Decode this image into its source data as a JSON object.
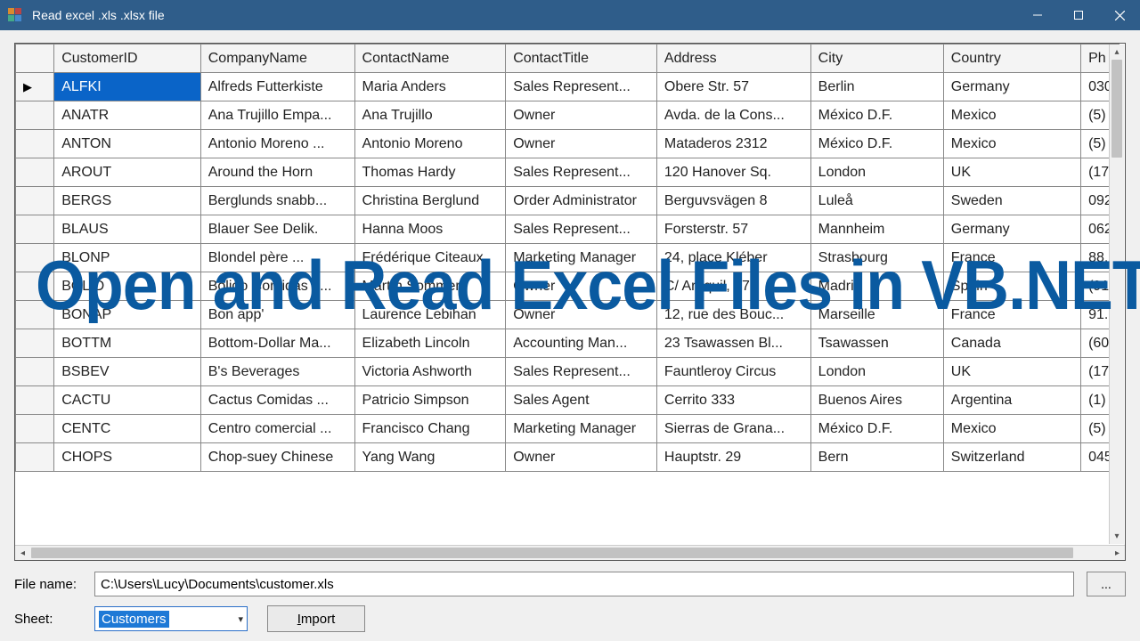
{
  "window": {
    "title": "Read excel .xls .xlsx file"
  },
  "overlay": "Open and Read Excel Files in VB.NET",
  "grid": {
    "columns": [
      "CustomerID",
      "CompanyName",
      "ContactName",
      "ContactTitle",
      "Address",
      "City",
      "Country",
      "Ph"
    ],
    "rows": [
      {
        "sel": true,
        "id": "ALFKI",
        "comp": "Alfreds Futterkiste",
        "contact": "Maria Anders",
        "title": "Sales Represent...",
        "addr": "Obere Str. 57",
        "city": "Berlin",
        "country": "Germany",
        "phone": "030"
      },
      {
        "id": "ANATR",
        "comp": "Ana Trujillo Empa...",
        "contact": "Ana Trujillo",
        "title": "Owner",
        "addr": "Avda. de la Cons...",
        "city": "México D.F.",
        "country": "Mexico",
        "phone": "(5)"
      },
      {
        "id": "ANTON",
        "comp": "Antonio Moreno ...",
        "contact": "Antonio Moreno",
        "title": "Owner",
        "addr": "Mataderos  2312",
        "city": "México D.F.",
        "country": "Mexico",
        "phone": "(5)"
      },
      {
        "id": "AROUT",
        "comp": "Around the Horn",
        "contact": "Thomas Hardy",
        "title": "Sales Represent...",
        "addr": "120 Hanover Sq.",
        "city": "London",
        "country": "UK",
        "phone": "(17"
      },
      {
        "id": "BERGS",
        "comp": "Berglunds snabb...",
        "contact": "Christina Berglund",
        "title": "Order Administrator",
        "addr": "Berguvsvägen  8",
        "city": "Luleå",
        "country": "Sweden",
        "phone": "092"
      },
      {
        "id": "BLAUS",
        "comp": "Blauer See Delik.",
        "contact": "Hanna Moos",
        "title": "Sales Represent...",
        "addr": "Forsterstr. 57",
        "city": "Mannheim",
        "country": "Germany",
        "phone": "062"
      },
      {
        "id": "BLONP",
        "comp": "Blondel père ...",
        "contact": "Frédérique Citeaux",
        "title": "Marketing Manager",
        "addr": "24, place Kléber",
        "city": "Strasbourg",
        "country": "France",
        "phone": "88."
      },
      {
        "id": "BOLID",
        "comp": "Bólido Comidas p...",
        "contact": "Martín Sommer",
        "title": "Owner",
        "addr": "C/ Araquil, 67",
        "city": "Madrid",
        "country": "Spain",
        "phone": "(91"
      },
      {
        "id": "BONAP",
        "comp": "Bon app'",
        "contact": "Laurence Lebihan",
        "title": "Owner",
        "addr": "12, rue des Bouc...",
        "city": "Marseille",
        "country": "France",
        "phone": "91."
      },
      {
        "id": "BOTTM",
        "comp": "Bottom-Dollar Ma...",
        "contact": "Elizabeth Lincoln",
        "title": "Accounting Man...",
        "addr": "23 Tsawassen Bl...",
        "city": "Tsawassen",
        "country": "Canada",
        "phone": "(60"
      },
      {
        "id": "BSBEV",
        "comp": "B's Beverages",
        "contact": "Victoria Ashworth",
        "title": "Sales Represent...",
        "addr": "Fauntleroy Circus",
        "city": "London",
        "country": "UK",
        "phone": "(17"
      },
      {
        "id": "CACTU",
        "comp": "Cactus Comidas ...",
        "contact": "Patricio Simpson",
        "title": "Sales Agent",
        "addr": "Cerrito 333",
        "city": "Buenos Aires",
        "country": "Argentina",
        "phone": "(1)"
      },
      {
        "id": "CENTC",
        "comp": "Centro comercial ...",
        "contact": "Francisco Chang",
        "title": "Marketing Manager",
        "addr": "Sierras de Grana...",
        "city": "México D.F.",
        "country": "Mexico",
        "phone": "(5)"
      },
      {
        "id": "CHOPS",
        "comp": "Chop-suey Chinese",
        "contact": "Yang Wang",
        "title": "Owner",
        "addr": "Hauptstr. 29",
        "city": "Bern",
        "country": "Switzerland",
        "phone": "045"
      }
    ]
  },
  "form": {
    "filename_label": "File name:",
    "filename_value": "C:\\Users\\Lucy\\Documents\\customer.xls",
    "browse_label": "...",
    "sheet_label": "Sheet:",
    "sheet_value": "Customers",
    "import_prefix": "I",
    "import_rest": "mport"
  }
}
